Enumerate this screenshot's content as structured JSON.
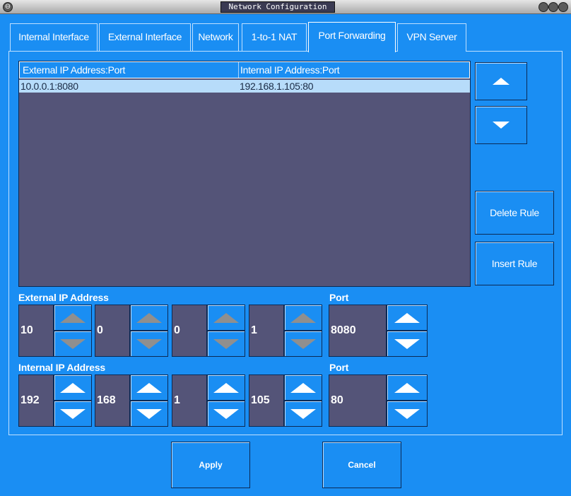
{
  "window": {
    "title": "Network Configuration"
  },
  "tabs": [
    {
      "label": "Internal Interface"
    },
    {
      "label": "External Interface"
    },
    {
      "label": "Network"
    },
    {
      "label": "1-to-1 NAT"
    },
    {
      "label": "Port Forwarding"
    },
    {
      "label": "VPN Server"
    }
  ],
  "active_tab": "Port Forwarding",
  "table": {
    "headers": [
      "External IP Address:Port",
      "Internal IP Address:Port"
    ],
    "rows": [
      [
        "10.0.0.1:8080",
        "192.168.1.105:80"
      ]
    ]
  },
  "side_buttons": {
    "delete_label": "Delete Rule",
    "insert_label": "Insert Rule"
  },
  "external": {
    "label": "External IP Address",
    "port_label": "Port",
    "octets": [
      "10",
      "0",
      "0",
      "1"
    ],
    "port": "8080"
  },
  "internal": {
    "label": "Internal IP Address",
    "port_label": "Port",
    "octets": [
      "192",
      "168",
      "1",
      "105"
    ],
    "port": "80"
  },
  "dialog": {
    "apply_label": "Apply",
    "cancel_label": "Cancel"
  },
  "colors": {
    "background": "#1a8ef3",
    "list_background": "#545478",
    "selected_row": "#b7dcfa"
  }
}
